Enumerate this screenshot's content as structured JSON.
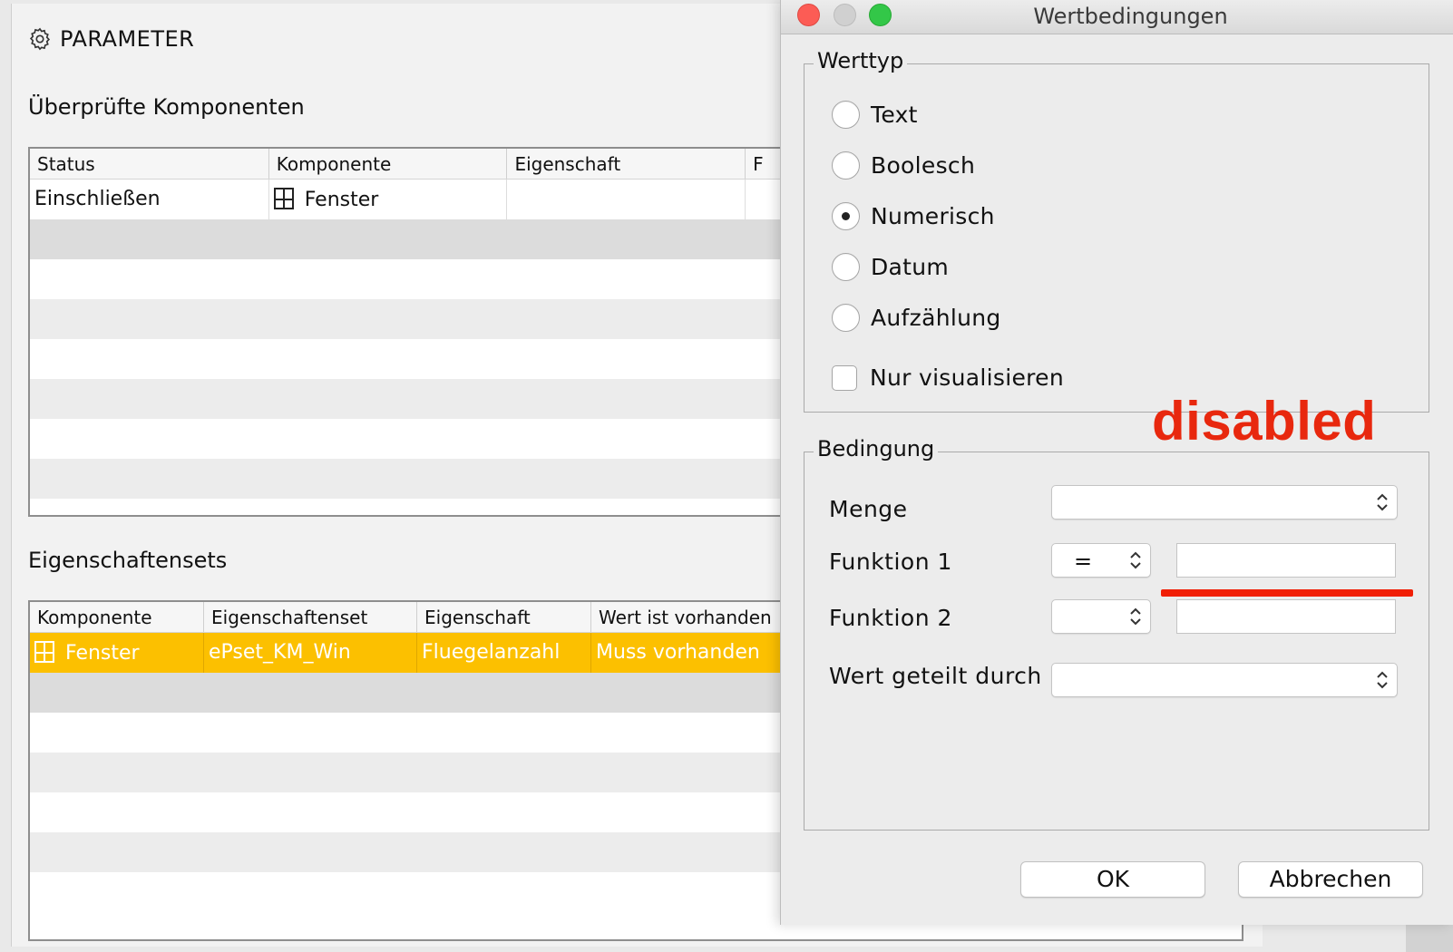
{
  "main": {
    "header": {
      "title": "PARAMETER",
      "icon": "gear-icon"
    },
    "components": {
      "title": "Überprüfte Komponenten",
      "columns": [
        "Status",
        "Komponente",
        "Eigenschaft",
        "F"
      ],
      "row": {
        "status": "Einschließen",
        "component": "Fenster",
        "property": ""
      }
    },
    "property_sets": {
      "title": "Eigenschaftensets",
      "columns": [
        "Komponente",
        "Eigenschaftenset",
        "Eigenschaft",
        "Wert ist vorhanden"
      ],
      "row": {
        "component": "Fenster",
        "set": "ePset_KM_Win",
        "property": "Fluegelanzahl",
        "value": "Muss vorhanden"
      }
    }
  },
  "dialog": {
    "title": "Wertbedingungen",
    "werttyp": {
      "label": "Werttyp",
      "options": [
        "Text",
        "Boolesch",
        "Numerisch",
        "Datum",
        "Aufzählung"
      ],
      "selected": "Numerisch",
      "checkbox_label": "Nur visualisieren",
      "checkbox_checked": false
    },
    "annotation": "disabled",
    "bedingung": {
      "label": "Bedingung",
      "menge_label": "Menge",
      "menge_value": "",
      "funktion1_label": "Funktion 1",
      "funktion1_op": "=",
      "funktion1_value": "",
      "funktion2_label": "Funktion 2",
      "funktion2_op": "",
      "funktion2_value": "",
      "divisor_label": "Wert geteilt durch",
      "divisor_value": ""
    },
    "ok_label": "OK",
    "cancel_label": "Abbrechen"
  },
  "colors": {
    "selection": "#fcc000",
    "annotation": "#e8280e"
  }
}
